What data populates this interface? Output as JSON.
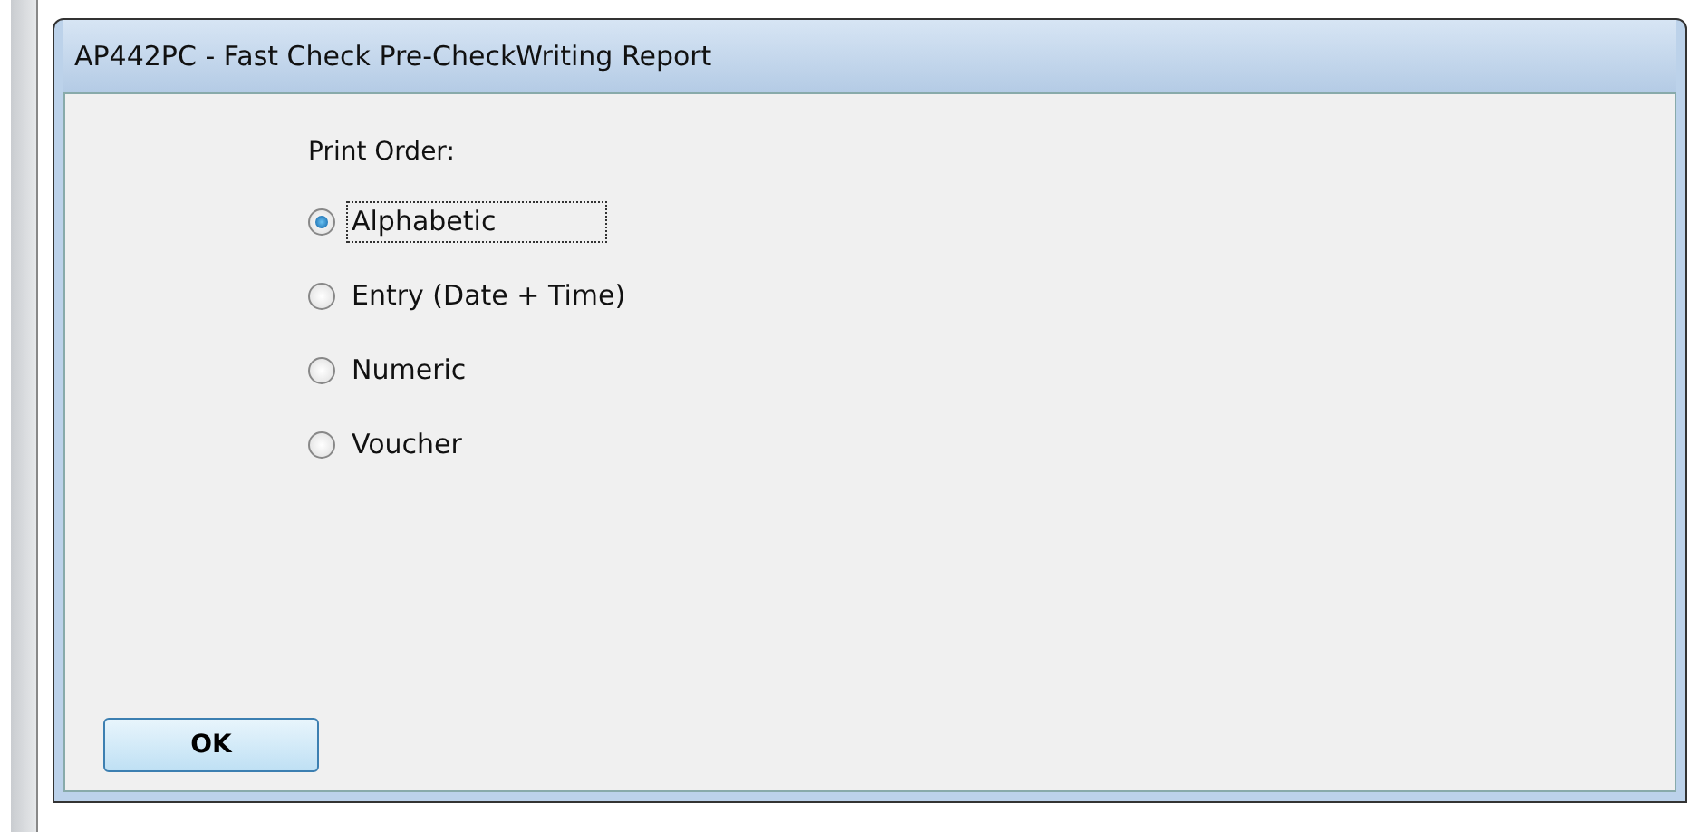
{
  "window": {
    "title": "AP442PC - Fast Check Pre-CheckWriting Report"
  },
  "print_order": {
    "label": "Print Order:",
    "options": [
      {
        "label": "Alphabetic",
        "selected": true
      },
      {
        "label": "Entry (Date + Time)",
        "selected": false
      },
      {
        "label": "Numeric",
        "selected": false
      },
      {
        "label": "Voucher",
        "selected": false
      }
    ]
  },
  "buttons": [
    "OK"
  ]
}
